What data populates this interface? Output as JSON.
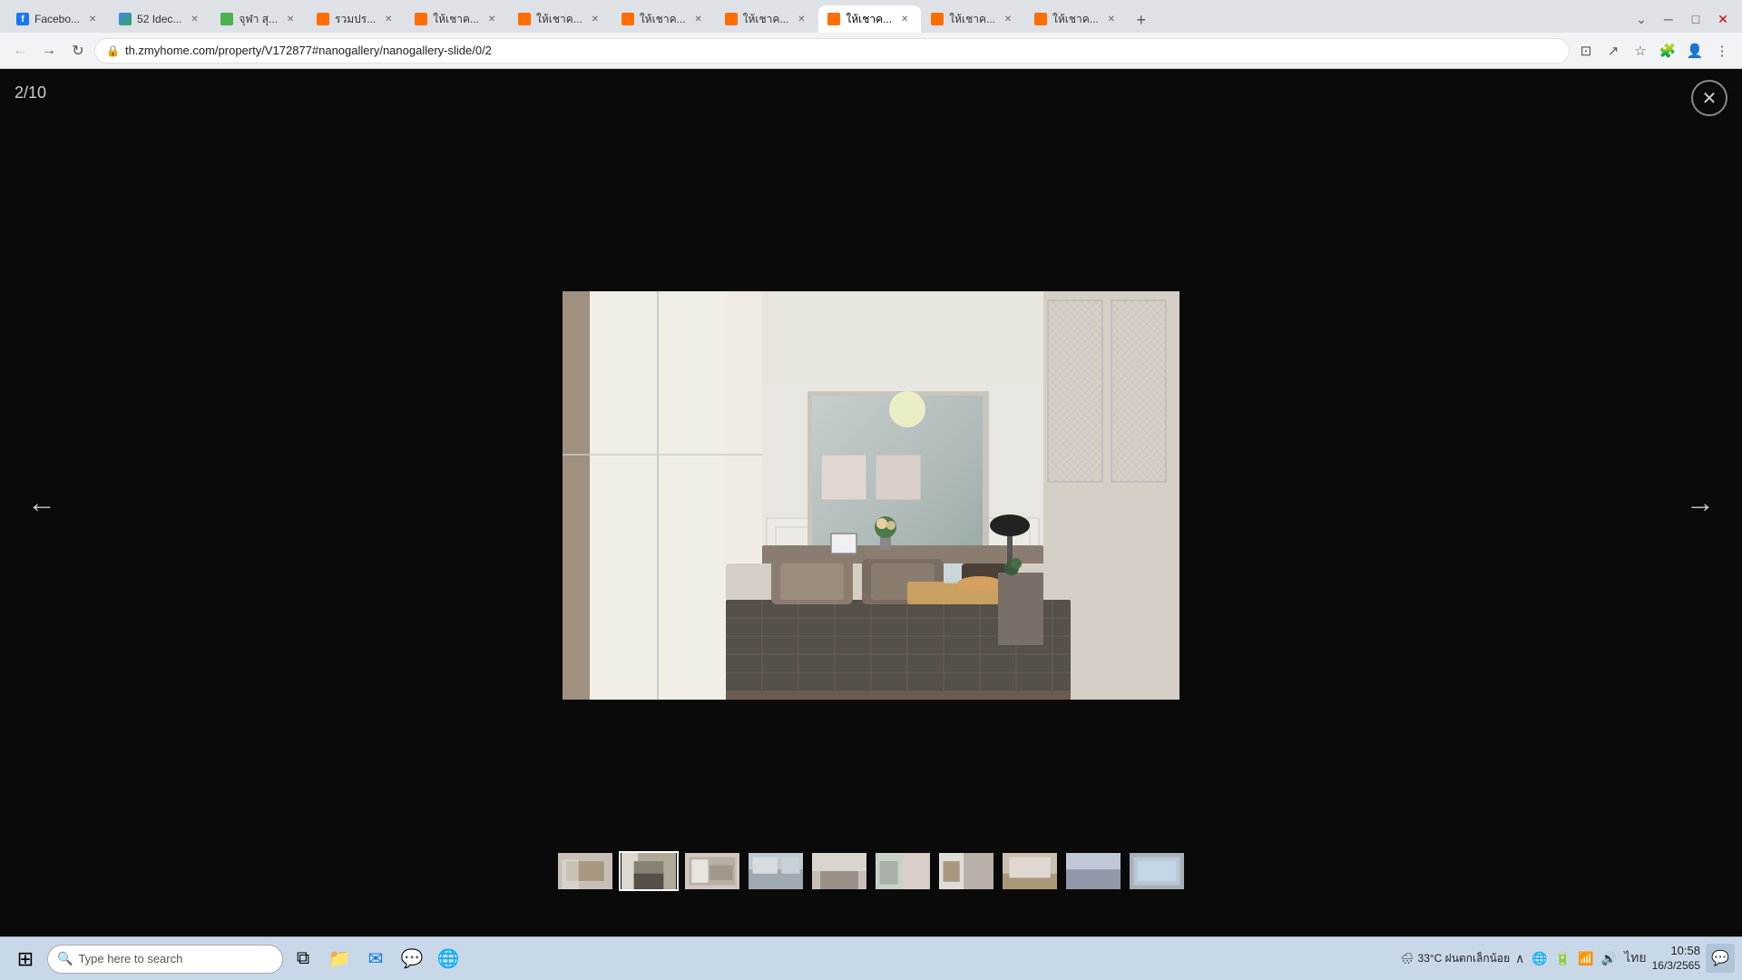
{
  "browser": {
    "tabs": [
      {
        "id": 1,
        "label": "Facebo...",
        "favicon_type": "fb",
        "active": false
      },
      {
        "id": 2,
        "label": "52 Idec...",
        "favicon_type": "gd",
        "active": false
      },
      {
        "id": 3,
        "label": "จุฬา สุ...",
        "favicon_type": "green",
        "active": false
      },
      {
        "id": 4,
        "label": "รวมปร...",
        "favicon_type": "orange",
        "active": false
      },
      {
        "id": 5,
        "label": "ให้เชาค...",
        "favicon_type": "orange",
        "active": false
      },
      {
        "id": 6,
        "label": "ให้เชาค...",
        "favicon_type": "orange",
        "active": false
      },
      {
        "id": 7,
        "label": "ให้เชาค...",
        "favicon_type": "orange",
        "active": false
      },
      {
        "id": 8,
        "label": "ให้เชาค...",
        "favicon_type": "orange",
        "active": false
      },
      {
        "id": 9,
        "label": "ให้เชาค...",
        "favicon_type": "orange",
        "active": true
      },
      {
        "id": 10,
        "label": "ให้เชาค...",
        "favicon_type": "orange",
        "active": false
      },
      {
        "id": 11,
        "label": "ให้เชาค...",
        "favicon_type": "orange",
        "active": false
      }
    ],
    "url": "th.zmyhome.com/property/V172877#nanogallery/nanogallery-slide/0/2"
  },
  "gallery": {
    "slide_counter": "2/10",
    "close_label": "✕",
    "prev_arrow": "←",
    "next_arrow": "→",
    "thumbnails": [
      {
        "index": 0,
        "active": false
      },
      {
        "index": 1,
        "active": true
      },
      {
        "index": 2,
        "active": false
      },
      {
        "index": 3,
        "active": false
      },
      {
        "index": 4,
        "active": false
      },
      {
        "index": 5,
        "active": false
      },
      {
        "index": 6,
        "active": false
      },
      {
        "index": 7,
        "active": false
      },
      {
        "index": 8,
        "active": false
      },
      {
        "index": 9,
        "active": false
      }
    ]
  },
  "taskbar": {
    "search_placeholder": "Type here to search",
    "weather": "33°C ฝนตกเล็กน้อย",
    "time": "10:58",
    "date": "16/3/2565",
    "lang": "ไทย"
  }
}
